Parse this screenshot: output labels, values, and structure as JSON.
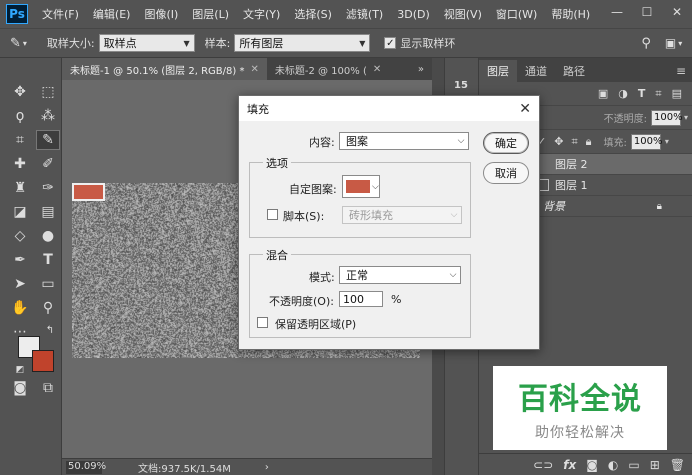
{
  "app": {
    "logo": "Ps",
    "menu": [
      "文件(F)",
      "编辑(E)",
      "图像(I)",
      "图层(L)",
      "文字(Y)",
      "选择(S)",
      "滤镜(T)",
      "3D(D)",
      "视图(V)",
      "窗口(W)",
      "帮助(H)"
    ],
    "window_controls": [
      "—",
      "☐",
      "✕"
    ]
  },
  "options_bar": {
    "sample_size_label": "取样大小:",
    "sample_size_value": "取样点",
    "sample_label": "样本:",
    "sample_value": "所有图层",
    "show_ring_label": "显示取样环",
    "show_ring_checked": true
  },
  "document_tabs": [
    {
      "title": "未标题-1 @ 50.1% (图层 2, RGB/8) *",
      "active": true
    },
    {
      "title": "未标题-2 @ 100% (",
      "active": false
    }
  ],
  "status": {
    "zoom": "50.09%",
    "doc_size": "文档:937.5K/1.54M"
  },
  "colors": {
    "foreground": "#ededed",
    "background": "#c0432c",
    "pattern_swatch": "#c85a45",
    "watermark_green": "#2aa04a"
  },
  "layers_panel": {
    "tabs": [
      "图层",
      "通道",
      "路径"
    ],
    "active_tab": "图层",
    "opacity_label": "不透明度:",
    "opacity_value": "100%",
    "fill_label": "填充:",
    "fill_value": "100%",
    "layers": [
      {
        "name": "图层 2",
        "active": true,
        "locked": false
      },
      {
        "name": "图层 1",
        "active": false,
        "locked": false
      },
      {
        "name": "背景",
        "active": false,
        "locked": true
      }
    ],
    "footer_icons": [
      "link-icon",
      "fx-icon",
      "mask-icon",
      "adjustment-icon",
      "folder-icon",
      "new-layer-icon",
      "trash-icon"
    ]
  },
  "mini_panel": {
    "icon_label": "15"
  },
  "watermark": {
    "title": "百科全说",
    "subtitle": "助你轻松解决"
  },
  "dialog": {
    "title": "填充",
    "content_label": "内容:",
    "content_value": "图案",
    "ok_label": "确定",
    "cancel_label": "取消",
    "options_group": "选项",
    "custom_pattern_label": "自定图案:",
    "script_label": "脚本(S):",
    "script_checked": false,
    "script_value": "砖形填充",
    "blend_group": "混合",
    "mode_label": "模式:",
    "mode_value": "正常",
    "opacity_label": "不透明度(O):",
    "opacity_value": "100",
    "opacity_unit": "%",
    "preserve_label": "保留透明区域(P)",
    "preserve_checked": false
  }
}
